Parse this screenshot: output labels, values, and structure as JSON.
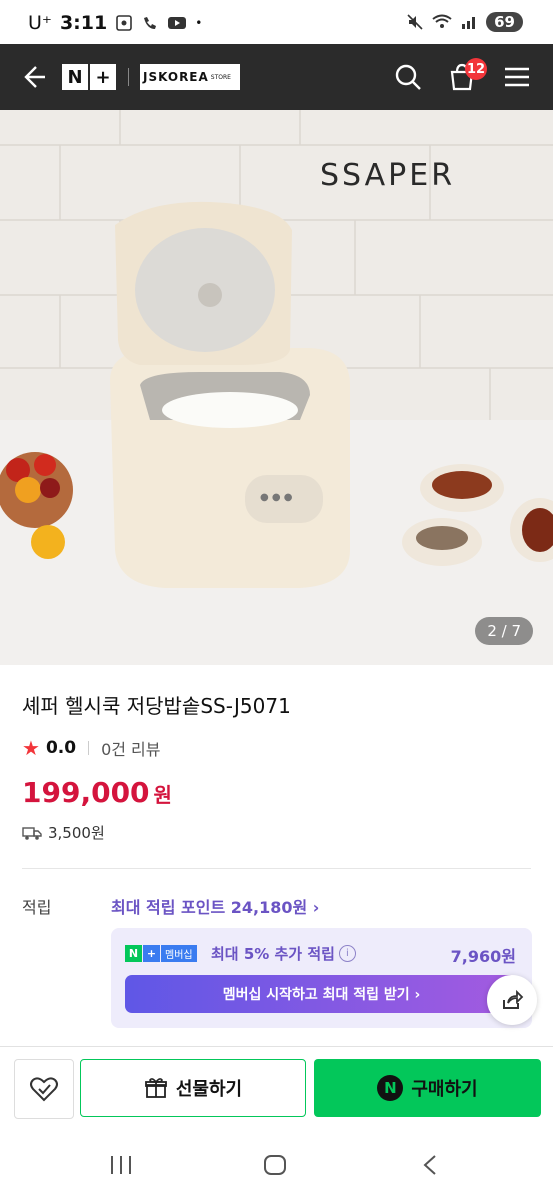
{
  "status_bar": {
    "carrier": "U⁺",
    "time": "3:11",
    "battery": "69"
  },
  "header": {
    "brand_np": [
      "N",
      "+"
    ],
    "store_name": "JSKOREA",
    "store_suffix": "STORE",
    "cart_count": "12"
  },
  "hero": {
    "brand_text": "SSAPER",
    "counter": "2 / 7"
  },
  "product": {
    "title": "셰퍼 헬시쿡 저당밥솥SS-J5071",
    "rating": "0.0",
    "reviews": "0건 리뷰",
    "price": "199,000",
    "price_unit": "원",
    "shipping": "3,500원"
  },
  "points": {
    "label": "적립",
    "max_text": "최대 적립 포인트 24,180원 ›",
    "member_badge": "멤버십",
    "member_text": "최대 5% 추가 적립",
    "member_amount": "7,960원",
    "member_button": "멤버십 시작하고 최대 적립 받기 ›"
  },
  "actions": {
    "gift": "선물하기",
    "buy": "구매하기",
    "buy_logo": "N"
  },
  "colors": {
    "price": "#d4143d",
    "naver_green": "#03c75a",
    "points_purple": "#6b54c4"
  }
}
